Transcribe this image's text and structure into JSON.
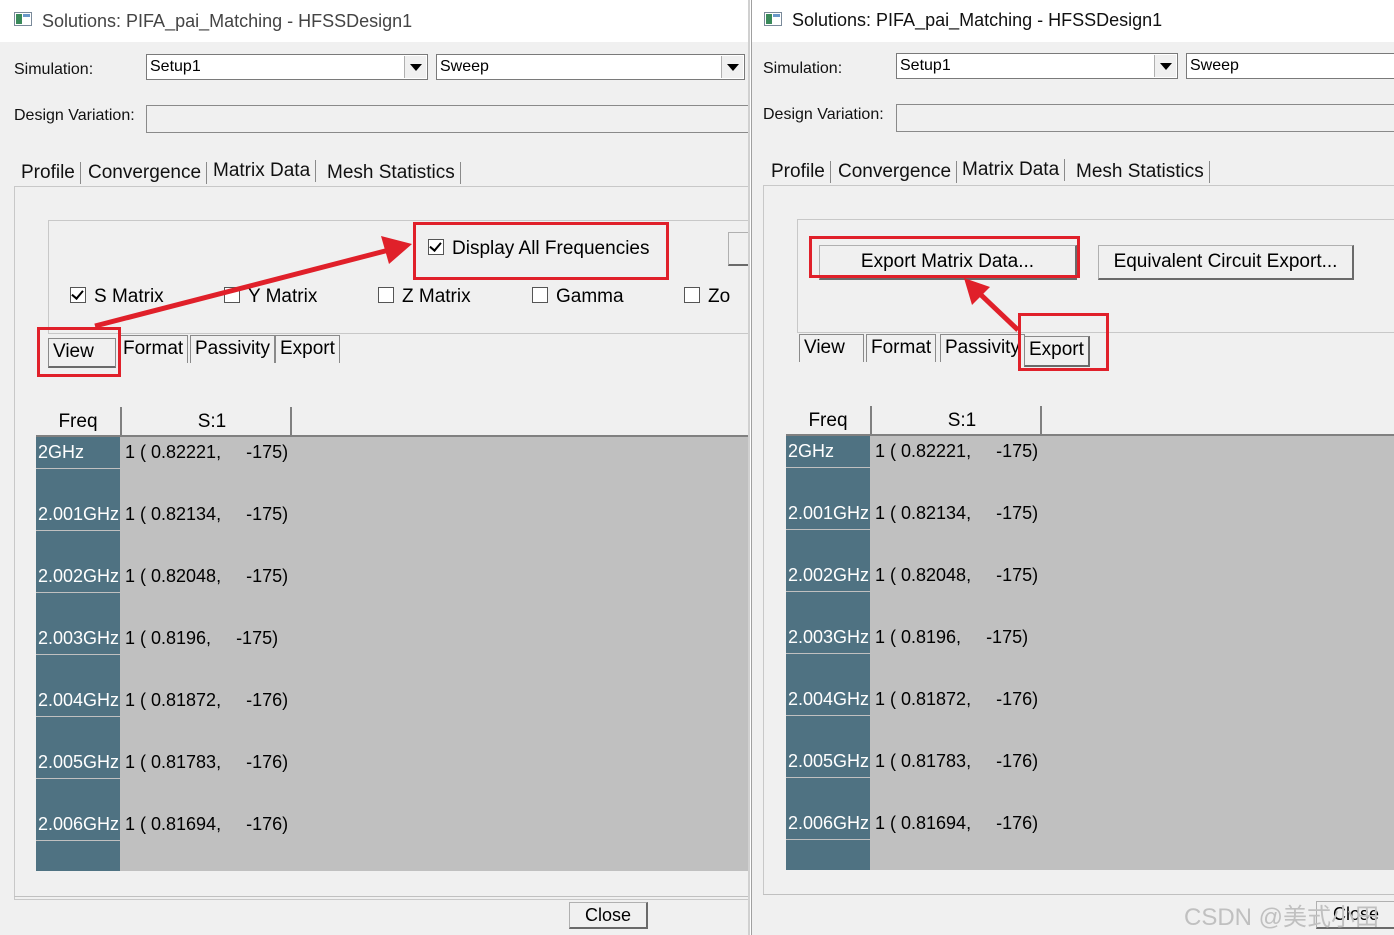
{
  "left": {
    "title": "Solutions: PIFA_pai_Matching - HFSSDesign1",
    "simulation_label": "Simulation:",
    "setup": "Setup1",
    "sweep": "Sweep",
    "design_variation_label": "Design Variation:",
    "tabs": [
      "Profile",
      "Convergence",
      "Matrix Data",
      "Mesh Statistics"
    ],
    "display_all_frequencies": "Display All Frequencies",
    "checks": [
      "S Matrix",
      "Y Matrix",
      "Z Matrix",
      "Gamma",
      "Zo"
    ],
    "subtabs": [
      "View",
      "Format",
      "Passivity",
      "Export"
    ],
    "close": "Close"
  },
  "right": {
    "title": "Solutions: PIFA_pai_Matching - HFSSDesign1",
    "simulation_label": "Simulation:",
    "setup": "Setup1",
    "sweep": "Sweep",
    "design_variation_label": "Design Variation:",
    "tabs": [
      "Profile",
      "Convergence",
      "Matrix Data",
      "Mesh Statistics"
    ],
    "export_matrix_button": "Export Matrix Data...",
    "equivalent_circuit_button": "Equivalent Circuit Export...",
    "subtabs": [
      "View",
      "Format",
      "Passivity",
      "Export"
    ],
    "close": "Close"
  },
  "grid": {
    "headers": [
      "Freq",
      "S:1"
    ],
    "rows": [
      {
        "freq": "2GHz",
        "value": "1 ( 0.82221,     -175)"
      },
      {
        "freq": "2.001GHz",
        "value": "1 ( 0.82134,     -175)"
      },
      {
        "freq": "2.002GHz",
        "value": "1 ( 0.82048,     -175)"
      },
      {
        "freq": "2.003GHz",
        "value": "1 ( 0.8196,     -175)"
      },
      {
        "freq": "2.004GHz",
        "value": "1 ( 0.81872,     -176)"
      },
      {
        "freq": "2.005GHz",
        "value": "1 ( 0.81783,     -176)"
      },
      {
        "freq": "2.006GHz",
        "value": "1 ( 0.81694,     -176)"
      }
    ]
  },
  "watermark": "CSDN @美式小田",
  "colors": {
    "highlight": "#e0202a",
    "freq_bg": "#4f7282",
    "grid_bg": "#c0c0c0"
  }
}
